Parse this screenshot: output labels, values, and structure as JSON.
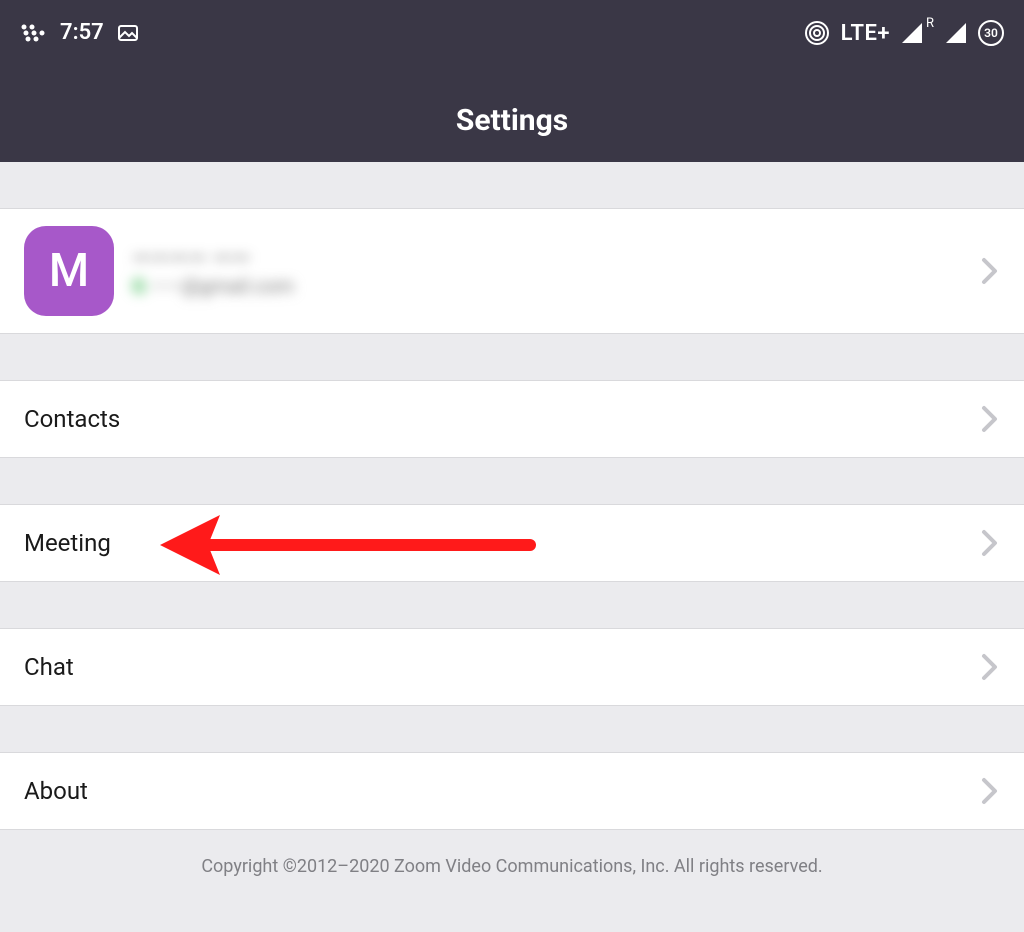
{
  "status": {
    "time": "7:57",
    "network_label": "LTE+",
    "roaming": "R",
    "battery": "30"
  },
  "header": {
    "title": "Settings"
  },
  "profile": {
    "avatar_initial": "M",
    "name_placeholder": "———— ——",
    "email_placeholder": "——@gmail.com"
  },
  "menu": {
    "contacts": "Contacts",
    "meeting": "Meeting",
    "chat": "Chat",
    "about": "About"
  },
  "footer": {
    "copyright": "Copyright ©2012–2020 Zoom Video Communications, Inc. All rights reserved."
  }
}
